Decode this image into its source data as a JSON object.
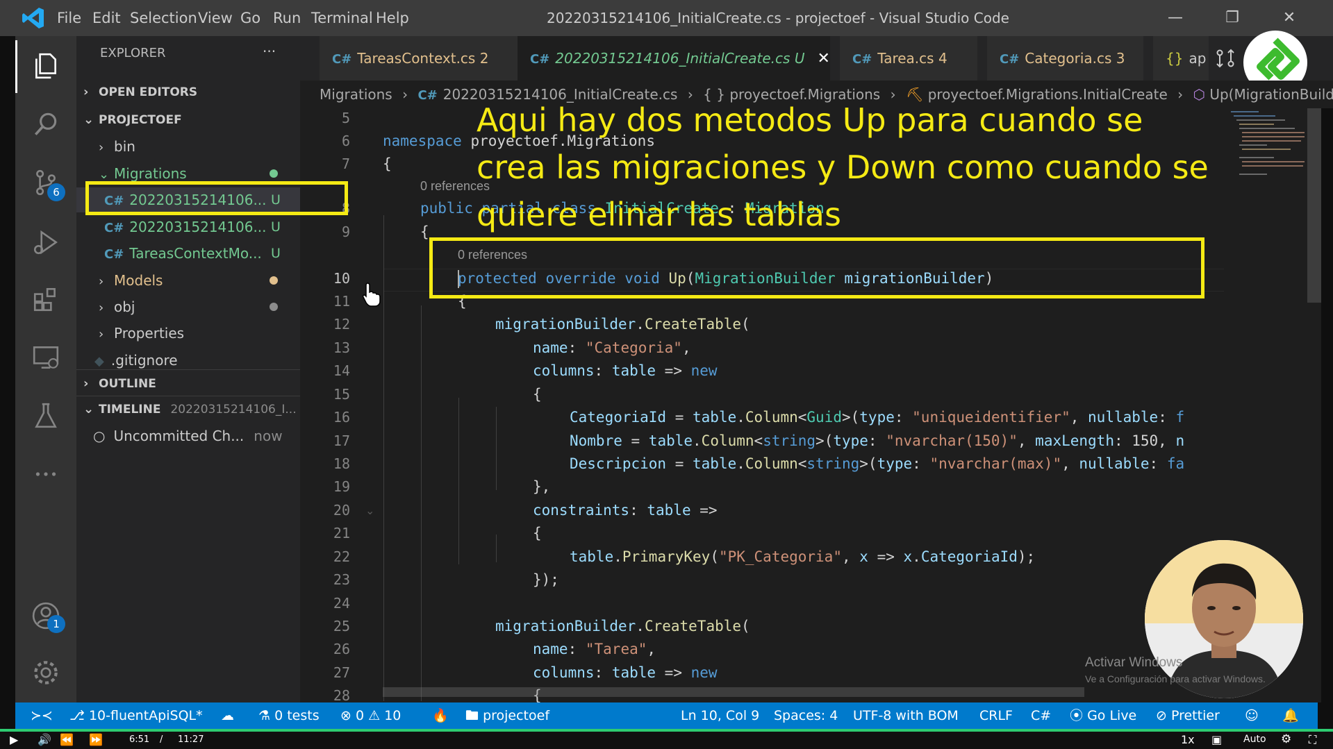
{
  "titlebar": {
    "menu": [
      "File",
      "Edit",
      "Selection",
      "View",
      "Go",
      "Run",
      "Terminal",
      "Help"
    ],
    "window_title": "20220315214106_InitialCreate.cs - projectoef - Visual Studio Code"
  },
  "activity": {
    "scm_badge": "6",
    "accounts_badge": "1"
  },
  "sidebar": {
    "explorer_title": "EXPLORER",
    "more": "···",
    "open_editors": "OPEN EDITORS",
    "project": "PROJECTOEF",
    "tree": [
      {
        "label": "bin",
        "kind": "folder"
      },
      {
        "label": "Migrations",
        "kind": "folder-open",
        "status": "green"
      },
      {
        "label": "20220315214106...",
        "badge": "U",
        "kind": "file",
        "selected": true
      },
      {
        "label": "20220315214106...",
        "badge": "U",
        "kind": "file"
      },
      {
        "label": "TareasContextMo...",
        "badge": "U",
        "kind": "file"
      },
      {
        "label": "Models",
        "kind": "folder",
        "status": "yellow"
      },
      {
        "label": "obj",
        "kind": "folder",
        "status": "gray"
      },
      {
        "label": "Properties",
        "kind": "folder"
      },
      {
        "label": ".gitignore",
        "kind": "file-plain"
      }
    ],
    "outline": "OUTLINE",
    "timeline": "TIMELINE",
    "timeline_file": "20220315214106_I...",
    "timeline_entry": "Uncommitted Ch...",
    "timeline_time": "now"
  },
  "tabs": [
    {
      "label": "TareasContext.cs",
      "count": "2"
    },
    {
      "label": "20220315214106_InitialCreate.cs",
      "flag": "U",
      "active": true
    },
    {
      "label": "Tarea.cs",
      "count": "4"
    },
    {
      "label": "Categoria.cs",
      "count": "3"
    },
    {
      "label": "ap"
    }
  ],
  "breadcrumb": [
    "Migrations",
    "20220315214106_InitialCreate.cs",
    "{ } proyectoef.Migrations",
    "proyectoef.Migrations.InitialCreate",
    "Up(MigrationBuild"
  ],
  "editor": {
    "line_numbers": [
      "5",
      "6",
      "7",
      "8",
      "9",
      "10",
      "11",
      "12",
      "13",
      "14",
      "15",
      "16",
      "17",
      "18",
      "19",
      "20",
      "21",
      "22",
      "23",
      "24",
      "25",
      "26",
      "27",
      "28"
    ],
    "references": "0 references",
    "lines": {
      "l6_kw": "namespace",
      "l6_ns": "proyectoef.Migrations",
      "l7": "{",
      "l8_a": "public",
      "l8_b": "partial",
      "l8_c": "class",
      "l8_d": "InitialCreate",
      "l8_e": " : ",
      "l8_f": "Migration",
      "l9": "{",
      "l10_a": "protected",
      "l10_b": "override",
      "l10_c": "void",
      "l10_d": "Up",
      "l10_e": "(",
      "l10_f": "MigrationBuilder",
      "l10_g": "migrationBuilder",
      "l10_h": ")",
      "l11": "{",
      "l12_a": "migrationBuilder",
      "l12_b": ".",
      "l12_c": "CreateTable",
      "l12_d": "(",
      "l13_a": "name",
      "l13_b": ": ",
      "l13_c": "\"Categoria\"",
      "l13_d": ",",
      "l14_a": "columns",
      "l14_b": ": ",
      "l14_c": "table",
      "l14_d": " => ",
      "l14_e": "new",
      "l15": "{",
      "l16_a": "CategoriaId",
      "l16_b": " = ",
      "l16_c": "table",
      "l16_d": ".",
      "l16_e": "Column",
      "l16_f": "<",
      "l16_g": "Guid",
      "l16_h": ">(",
      "l16_i": "type",
      "l16_j": ": ",
      "l16_k": "\"uniqueidentifier\"",
      "l16_l": ", ",
      "l16_m": "nullable",
      "l16_n": ": ",
      "l16_o": "f",
      "l17_a": "Nombre",
      "l17_b": " = ",
      "l17_c": "table",
      "l17_d": ".",
      "l17_e": "Column",
      "l17_f": "<",
      "l17_g": "string",
      "l17_h": ">(",
      "l17_i": "type",
      "l17_j": ": ",
      "l17_k": "\"nvarchar(150)\"",
      "l17_l": ", ",
      "l17_m": "maxLength",
      "l17_n": ": 150, ",
      "l17_o": "n",
      "l18_a": "Descripcion",
      "l18_b": " = ",
      "l18_c": "table",
      "l18_d": ".",
      "l18_e": "Column",
      "l18_f": "<",
      "l18_g": "string",
      "l18_h": ">(",
      "l18_i": "type",
      "l18_j": ": ",
      "l18_k": "\"nvarchar(max)\"",
      "l18_l": ", ",
      "l18_m": "nullable",
      "l18_n": ": ",
      "l18_o": "fa",
      "l19": "},",
      "l20_a": "constraints",
      "l20_b": ": ",
      "l20_c": "table",
      "l20_d": " =>",
      "l21": "{",
      "l22_a": "table",
      "l22_b": ".",
      "l22_c": "PrimaryKey",
      "l22_d": "(",
      "l22_e": "\"PK_Categoria\"",
      "l22_f": ", ",
      "l22_g": "x",
      "l22_h": " => ",
      "l22_i": "x",
      "l22_j": ".",
      "l22_k": "CategoriaId",
      "l22_l": ");",
      "l23": "});",
      "l25_a": "migrationBuilder",
      "l25_b": ".",
      "l25_c": "CreateTable",
      "l25_d": "(",
      "l26_a": "name",
      "l26_b": ": ",
      "l26_c": "\"Tarea\"",
      "l26_d": ",",
      "l27_a": "columns",
      "l27_b": ": ",
      "l27_c": "table",
      "l27_d": " => ",
      "l27_e": "new",
      "l28": "{"
    }
  },
  "annotation": {
    "line1": "Aqui hay dos metodos Up para cuando se",
    "line2": "crea las migraciones y Down como cuando se",
    "line3": "quiere elinar las tablas"
  },
  "statusbar": {
    "branch": "10-fluentApiSQL*",
    "tests": "0 tests",
    "errors": "0",
    "warnings": "10",
    "project": "projectoef",
    "position": "Ln 10, Col 9",
    "spaces": "Spaces: 4",
    "encoding": "UTF-8 with BOM",
    "eol": "CRLF",
    "language": "C#",
    "golive": "Go Live",
    "prettier": "Prettier"
  },
  "watermark": {
    "line1": "Activar Windows",
    "line2": "Ve a Configuración para activar Windows."
  },
  "video": {
    "current_time": "6:51",
    "separator": "/",
    "duration": "11:27",
    "speed": "1x",
    "quality": "Auto"
  },
  "colors": {
    "accent": "#007acc",
    "annotation": "#f5ea14",
    "untracked": "#73c991",
    "modified": "#e2c08d"
  }
}
